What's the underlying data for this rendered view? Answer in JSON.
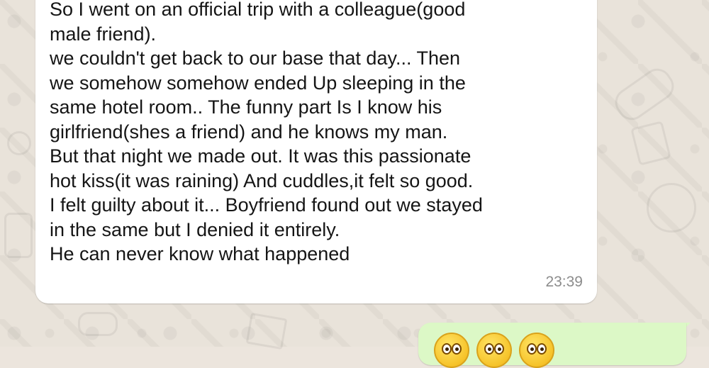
{
  "chat": {
    "incoming": {
      "lines": [
        "So I went on an official trip with a colleague(good",
        "male friend).",
        "we couldn't get back to our base that day... Then",
        "we somehow somehow ended Up sleeping in the",
        "same hotel room.. The funny part Is I know his",
        "girlfriend(shes a friend) and he knows my man.",
        "But that night we made out. It was this passionate",
        "hot kiss(it was raining) And cuddles,it felt so good.",
        "I felt guilty about it... Boyfriend found out we stayed",
        "in the same but I denied it entirely.",
        "He can never know what happened"
      ],
      "time": "23:39"
    },
    "outgoing": {
      "emojis": [
        "flushed-face-emoji",
        "flushed-face-emoji",
        "flushed-face-emoji"
      ]
    }
  },
  "colors": {
    "wallpaper": "#e9e3da",
    "incoming_bubble": "#ffffff",
    "outgoing_bubble": "#dcf8c6",
    "timestamp": "#8c8c8c"
  }
}
